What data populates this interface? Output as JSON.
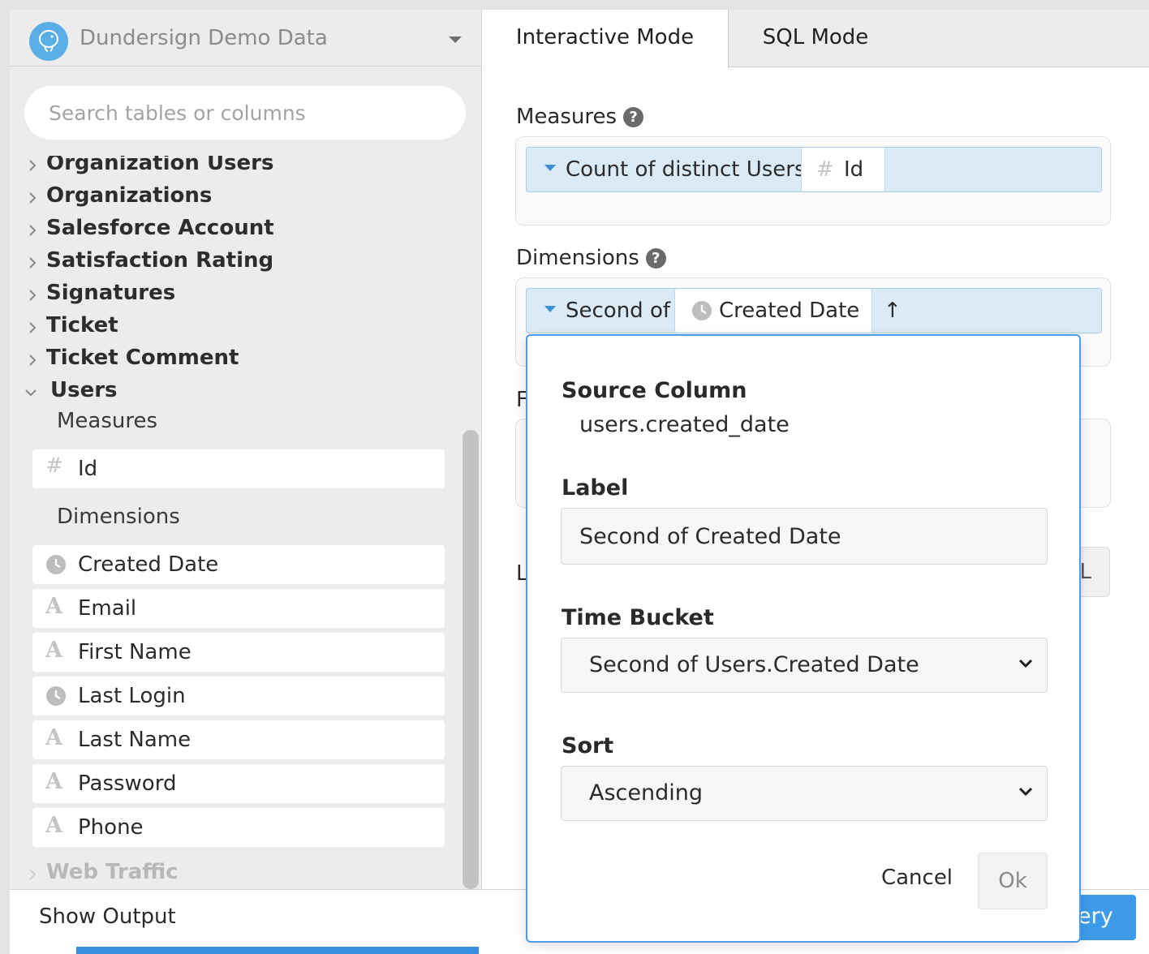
{
  "datasource": {
    "name": "Dundersign Demo Data",
    "icon": "postgres-elephant-icon"
  },
  "search": {
    "placeholder": "Search tables or columns"
  },
  "tree": {
    "tables": [
      {
        "label": "Organization Users",
        "state": "collapsed"
      },
      {
        "label": "Organizations",
        "state": "collapsed"
      },
      {
        "label": "Salesforce Account",
        "state": "collapsed"
      },
      {
        "label": "Satisfaction Rating",
        "state": "collapsed"
      },
      {
        "label": "Signatures",
        "state": "collapsed"
      },
      {
        "label": "Ticket",
        "state": "collapsed"
      },
      {
        "label": "Ticket Comment",
        "state": "collapsed"
      },
      {
        "label": "Users",
        "state": "expanded"
      },
      {
        "label": "Web Traffic",
        "state": "collapsed"
      }
    ],
    "measures_heading": "Measures",
    "dimensions_heading": "Dimensions",
    "measures": [
      {
        "label": "Id",
        "icon": "hash-icon"
      }
    ],
    "dimensions": [
      {
        "label": "Created Date",
        "icon": "clock-icon"
      },
      {
        "label": "Email",
        "icon": "text-type-icon"
      },
      {
        "label": "First Name",
        "icon": "text-type-icon"
      },
      {
        "label": "Last Login",
        "icon": "clock-icon"
      },
      {
        "label": "Last Name",
        "icon": "text-type-icon"
      },
      {
        "label": "Password",
        "icon": "text-type-icon"
      },
      {
        "label": "Phone",
        "icon": "text-type-icon"
      }
    ]
  },
  "tabs": [
    {
      "label": "Interactive Mode",
      "active": true
    },
    {
      "label": "SQL Mode",
      "active": false
    }
  ],
  "measures_section": {
    "label": "Measures",
    "pill": {
      "text": "Count of distinct Users",
      "chip_icon": "#",
      "chip_text": "Id"
    }
  },
  "dimensions_section": {
    "label": "Dimensions",
    "pill": {
      "text": "Second of",
      "chip_icon": "clock-icon",
      "chip_text": "Created Date",
      "sort_icon": "↑"
    }
  },
  "occluded": {
    "f_letter": "F",
    "l_letter": "L",
    "btn_fragment": "L"
  },
  "popover": {
    "source_heading": "Source Column",
    "source_value": "users.created_date",
    "label_heading": "Label",
    "label_value": "Second of Created Date",
    "time_bucket_heading": "Time Bucket",
    "time_bucket_value": "Second of Users.Created Date",
    "sort_heading": "Sort",
    "sort_value": "Ascending",
    "cancel_label": "Cancel",
    "ok_label": "Ok"
  },
  "bottom": {
    "show_output_label": "Show Output",
    "run_fragment": "ery"
  },
  "colors": {
    "accent": "#3d9be9",
    "pill_bg": "#dbeaf7",
    "pill_border": "#a9cdec",
    "panel_bg": "#ececec"
  }
}
